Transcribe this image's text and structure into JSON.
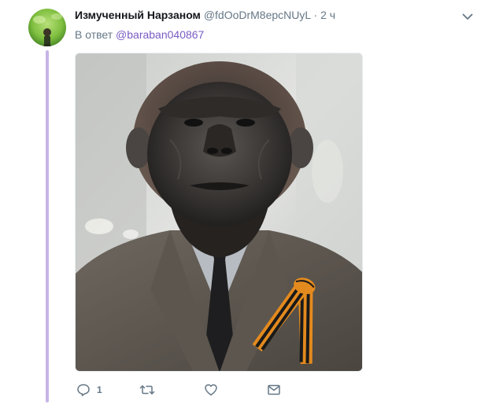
{
  "tweet": {
    "display_name": "Измученный Нарзаном",
    "handle": "@fdOoDrM8epcNUyL",
    "separator": "·",
    "time": "2 ч",
    "reply_prefix": "В ответ",
    "reply_to_handle": "@baraban040867",
    "image_description_icon": "photo",
    "colors": {
      "thread_line": "#c7b4e6",
      "link": "#7a5cc4",
      "secondary_text": "#657786"
    }
  },
  "actions": {
    "reply_count": "1",
    "reply_icon": "reply-icon",
    "retweet_icon": "retweet-icon",
    "like_icon": "like-icon",
    "dm_icon": "message-icon"
  }
}
